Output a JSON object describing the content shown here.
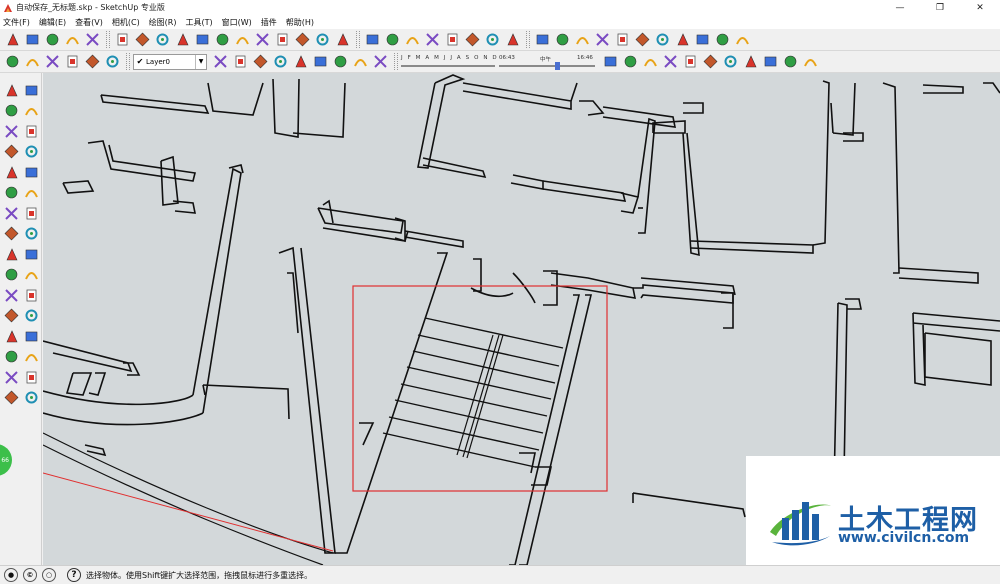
{
  "window": {
    "title": "自动保存_无标题.skp - SketchUp 专业版",
    "minimize_glyph": "—",
    "maximize_glyph": "❐",
    "close_glyph": "✕"
  },
  "menu": [
    "文件(F)",
    "编辑(E)",
    "查看(V)",
    "相机(C)",
    "绘图(R)",
    "工具(T)",
    "窗口(W)",
    "插件",
    "帮助(H)"
  ],
  "layer_selector": {
    "value": "Layer0"
  },
  "shadow_settings": {
    "months": "J F M A M J J A S O N D",
    "time_start": "06:43",
    "time_mid": "中午",
    "time_end": "16:46",
    "time_position": 0.6
  },
  "status_bar": {
    "message": "选择物体。使用Shift键扩大选择范围，拖拽鼠标进行多重选择。"
  },
  "side_badge": {
    "text": "66"
  },
  "watermark": {
    "name": "土木工程网",
    "url": "www.civilcn.com"
  },
  "colors": {
    "viewport_bg": "#d3d8da",
    "selection_box": "#e03030",
    "watermark_blue": "#1e5fa6",
    "watermark_green": "#5ab43c"
  },
  "icons": {
    "toolbar_1": [
      "select-icon",
      "pencil-icon",
      "rectangle-icon",
      "circle-icon",
      "arc-icon",
      "make-component-icon",
      "eraser-icon",
      "tape-measure-icon",
      "paint-bucket-icon",
      "push-pull-icon",
      "move-icon",
      "rotate-icon",
      "follow-me-icon",
      "orbit-icon",
      "pan-icon",
      "zoom-icon",
      "zoom-extents-icon",
      "3d-warehouse-icon",
      "get-models-icon",
      "share-model-icon",
      "extension-warehouse-icon",
      "component-icon",
      "style-icon",
      "layer-manager-icon",
      "material-icon",
      "ruby-m-icon",
      "tag-icon",
      "ruby-r-icon",
      "help-icon",
      "paint-tag-icon",
      "sun-icon",
      "fog-icon",
      "flag-icon",
      "sphere-icon",
      "sandbox-icon",
      "color-wheel-icon"
    ],
    "toolbar_2": [
      "iso-view-icon",
      "top-view-icon",
      "front-view-icon",
      "right-view-icon",
      "back-view-icon",
      "left-view-icon",
      "layer-tick-icon",
      "layer-manager-icon",
      "warehouse-home-icon",
      "house-icon",
      "home-icon",
      "window-icon",
      "house-outline-icon",
      "square-icon",
      "shadow-toggle-icon",
      "new-file-icon",
      "open-file-icon",
      "save-icon",
      "cut-icon",
      "copy-icon",
      "paste-icon",
      "delete-icon",
      "undo-icon",
      "redo-icon",
      "print-icon",
      "model-info-icon"
    ],
    "left": [
      "select-icon",
      "make-component-icon",
      "paint-bucket-icon",
      "eraser-icon",
      "rectangle-icon",
      "line-icon",
      "circle-icon",
      "arc-icon",
      "polygon-icon",
      "freehand-icon",
      "move-icon",
      "push-pull-icon",
      "rotate-icon",
      "follow-me-icon",
      "scale-icon",
      "offset-icon",
      "tape-measure-icon",
      "dimension-icon",
      "protractor-icon",
      "text-icon",
      "axes-icon",
      "3d-text-icon",
      "orbit-icon",
      "pan-icon",
      "zoom-icon",
      "zoom-window-icon",
      "zoom-extents-icon",
      "previous-view-icon",
      "position-camera-icon",
      "look-around-icon",
      "walk-icon",
      "section-plane-icon"
    ]
  }
}
